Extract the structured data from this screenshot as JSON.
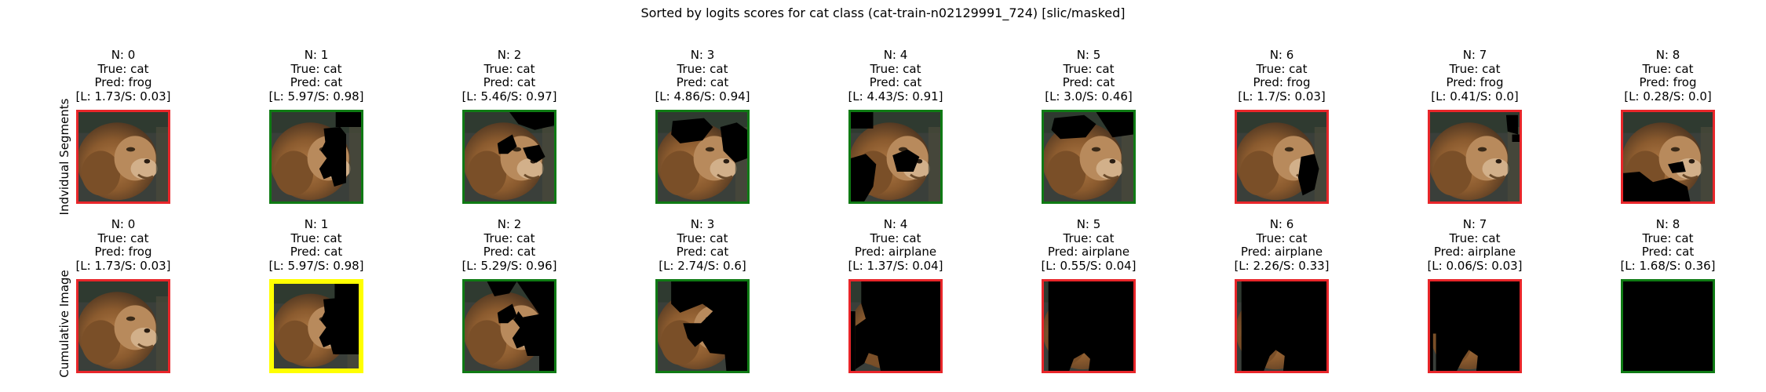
{
  "figure_title": "Sorted by logits scores for cat class (cat-train-n02129991_724) [slic/masked]",
  "row_labels": [
    "Indvidual Segments",
    "Cumulative Image"
  ],
  "border_colors": {
    "red": "#e8262a",
    "green": "#0f7a14",
    "yellow": "#ffff00"
  },
  "rows": [
    {
      "name": "individual",
      "cells": [
        {
          "n": "N: 0",
          "true": "True: cat",
          "pred": "Pred: frog",
          "score": "[L: 1.73/S: 0.03]",
          "border": "red",
          "mask": "none"
        },
        {
          "n": "N: 1",
          "true": "True: cat",
          "pred": "Pred: cat",
          "score": "[L: 5.97/S: 0.98]",
          "border": "green",
          "mask": "seg1"
        },
        {
          "n": "N: 2",
          "true": "True: cat",
          "pred": "Pred: cat",
          "score": "[L: 5.46/S: 0.97]",
          "border": "green",
          "mask": "seg2"
        },
        {
          "n": "N: 3",
          "true": "True: cat",
          "pred": "Pred: cat",
          "score": "[L: 4.86/S: 0.94]",
          "border": "green",
          "mask": "seg3"
        },
        {
          "n": "N: 4",
          "true": "True: cat",
          "pred": "Pred: cat",
          "score": "[L: 4.43/S: 0.91]",
          "border": "green",
          "mask": "seg4"
        },
        {
          "n": "N: 5",
          "true": "True: cat",
          "pred": "Pred: cat",
          "score": "[L: 3.0/S: 0.46]",
          "border": "green",
          "mask": "seg5"
        },
        {
          "n": "N: 6",
          "true": "True: cat",
          "pred": "Pred: frog",
          "score": "[L: 1.7/S: 0.03]",
          "border": "red",
          "mask": "seg6"
        },
        {
          "n": "N: 7",
          "true": "True: cat",
          "pred": "Pred: frog",
          "score": "[L: 0.41/S: 0.0]",
          "border": "red",
          "mask": "seg7"
        },
        {
          "n": "N: 8",
          "true": "True: cat",
          "pred": "Pred: frog",
          "score": "[L: 0.28/S: 0.0]",
          "border": "red",
          "mask": "seg8"
        }
      ]
    },
    {
      "name": "cumulative",
      "cells": [
        {
          "n": "N: 0",
          "true": "True: cat",
          "pred": "Pred: frog",
          "score": "[L: 1.73/S: 0.03]",
          "border": "red",
          "mask": "none"
        },
        {
          "n": "N: 1",
          "true": "True: cat",
          "pred": "Pred: cat",
          "score": "[L: 5.97/S: 0.98]",
          "border": "yellow",
          "mask": "cum1"
        },
        {
          "n": "N: 2",
          "true": "True: cat",
          "pred": "Pred: cat",
          "score": "[L: 5.29/S: 0.96]",
          "border": "green",
          "mask": "cum2"
        },
        {
          "n": "N: 3",
          "true": "True: cat",
          "pred": "Pred: cat",
          "score": "[L: 2.74/S: 0.6]",
          "border": "green",
          "mask": "cum3"
        },
        {
          "n": "N: 4",
          "true": "True: cat",
          "pred": "Pred: airplane",
          "score": "[L: 1.37/S: 0.04]",
          "border": "red",
          "mask": "cum4"
        },
        {
          "n": "N: 5",
          "true": "True: cat",
          "pred": "Pred: airplane",
          "score": "[L: 0.55/S: 0.04]",
          "border": "red",
          "mask": "cum5"
        },
        {
          "n": "N: 6",
          "true": "True: cat",
          "pred": "Pred: airplane",
          "score": "[L: 2.26/S: 0.33]",
          "border": "red",
          "mask": "cum6"
        },
        {
          "n": "N: 7",
          "true": "True: cat",
          "pred": "Pred: airplane",
          "score": "[L: 0.06/S: 0.03]",
          "border": "red",
          "mask": "cum7"
        },
        {
          "n": "N: 8",
          "true": "True: cat",
          "pred": "Pred: cat",
          "score": "[L: 1.68/S: 0.36]",
          "border": "green",
          "mask": "all"
        }
      ]
    }
  ]
}
